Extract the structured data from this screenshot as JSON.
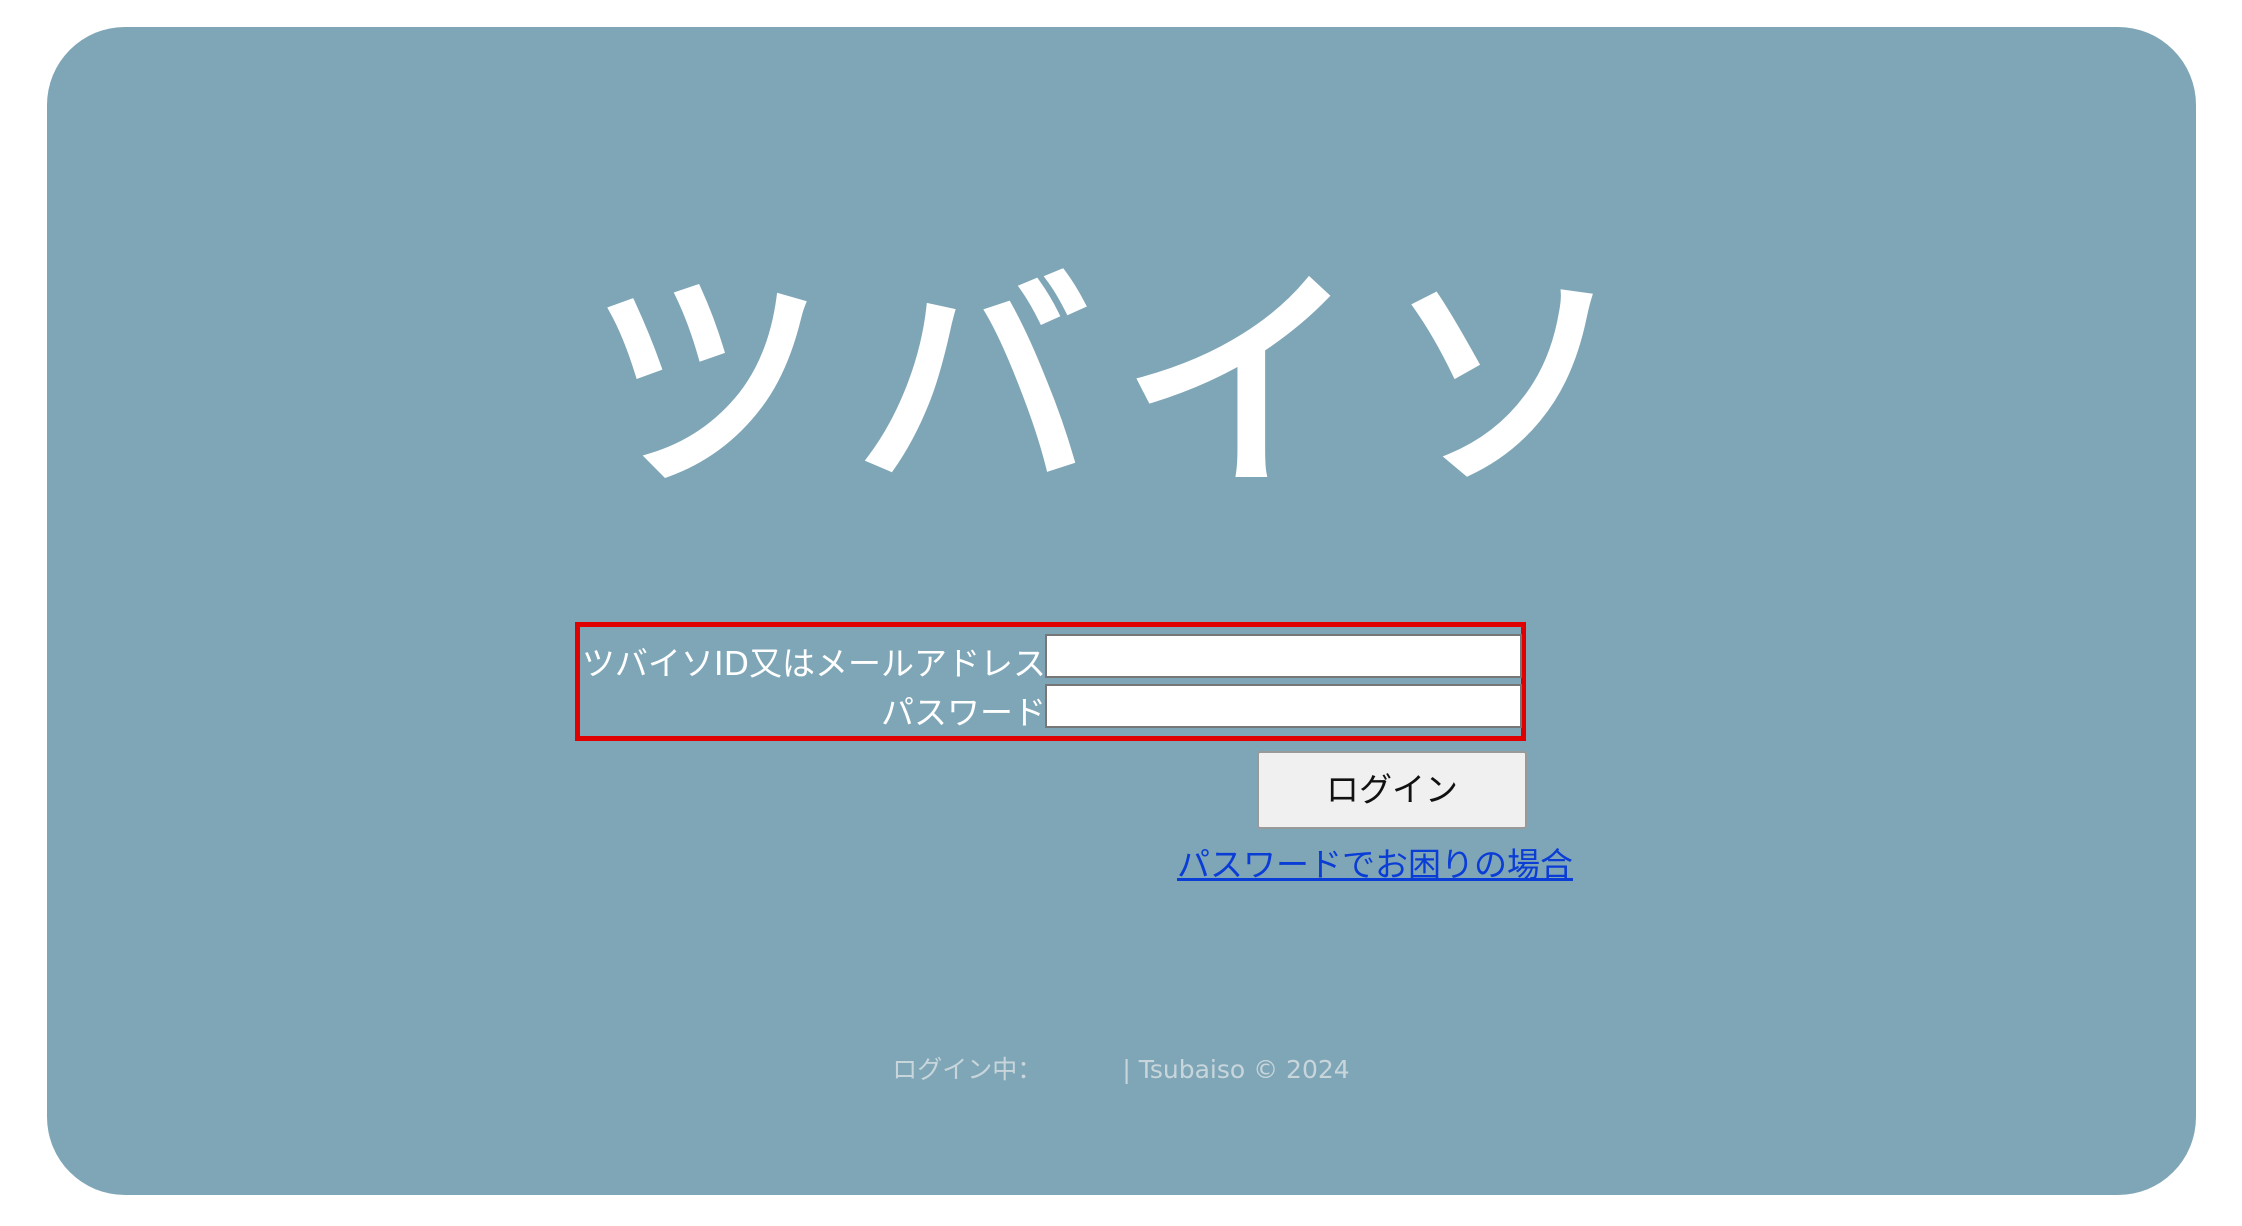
{
  "logo": {
    "text": "ツバイソ"
  },
  "login_form": {
    "id_label": "ツバイソID又はメールアドレス",
    "id_value": "",
    "password_label": "パスワード",
    "password_value": "",
    "login_button_label": "ログイン",
    "forgot_password_link": "パスワードでお困りの場合"
  },
  "footer": {
    "login_status_label": "ログイン中：",
    "separator": "|",
    "copyright": "Tsubaiso © 2024"
  },
  "colors": {
    "card_background": "#7fa6b7",
    "highlight_border": "#e00000",
    "link": "#0a3cd6"
  }
}
